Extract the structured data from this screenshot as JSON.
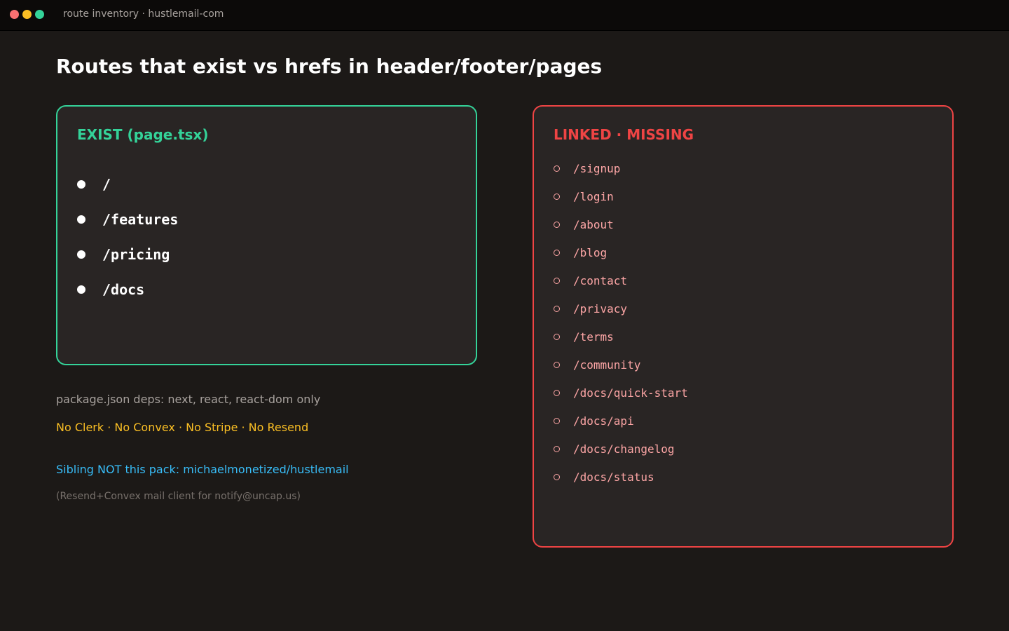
{
  "window": {
    "title": "route inventory · hustlemail-com"
  },
  "page": {
    "title": "Routes that exist vs hrefs in header/footer/pages"
  },
  "exist_panel": {
    "heading": "EXIST (page.tsx)",
    "accent_color": "#34d399",
    "routes": [
      "/",
      "/features",
      "/pricing",
      "/docs"
    ]
  },
  "missing_panel": {
    "heading": "LINKED · MISSING",
    "accent_color": "#ef4444",
    "routes": [
      "/signup",
      "/login",
      "/about",
      "/blog",
      "/contact",
      "/privacy",
      "/terms",
      "/community",
      "/docs/quick-start",
      "/docs/api",
      "/docs/changelog",
      "/docs/status"
    ]
  },
  "notes": {
    "deps": "package.json deps: next, react, react-dom only",
    "missing_services": "No Clerk · No Convex · No Stripe · No Resend",
    "sibling": "Sibling NOT this pack: michaelmonetized/hustlemail",
    "sibling_detail": "(Resend+Convex mail client for notify@uncap.us)"
  }
}
